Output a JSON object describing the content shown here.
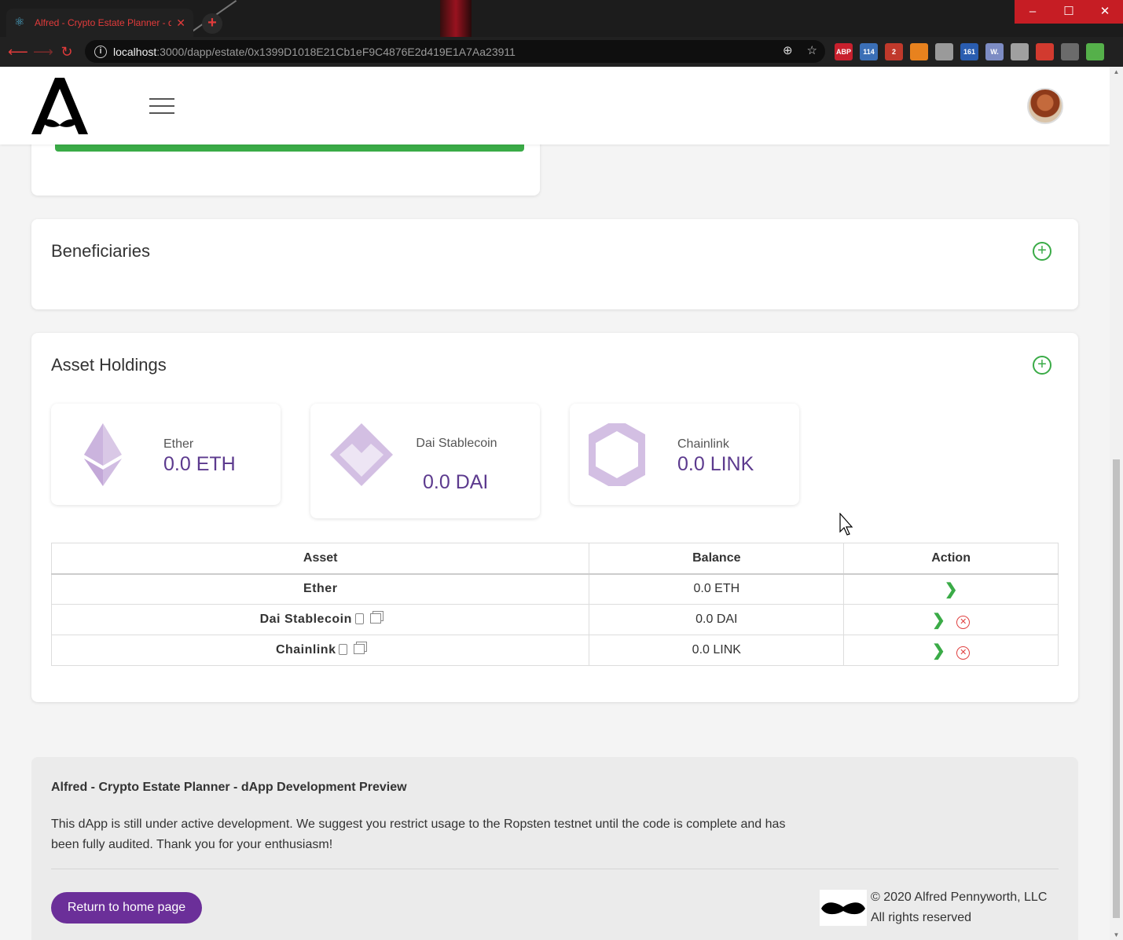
{
  "browser": {
    "tab_title": "Alfred - Crypto Estate Planner - d",
    "tab_close": "✕",
    "new_tab": "+",
    "url_host": "localhost",
    "url_rest": ":3000/dapp/estate/0x1399D1018E21Cb1eF9C4876E2d419E1A7Aa23911",
    "window_buttons": {
      "minimize": "–",
      "maximize": "☐",
      "close": "✕"
    },
    "extensions": [
      {
        "label": "ABP",
        "color": "#c8202d"
      },
      {
        "label": "114",
        "color": "#3b6fb6"
      },
      {
        "label": "2",
        "color": "#c0392b"
      },
      {
        "label": "",
        "color": "#e8821e"
      },
      {
        "label": "",
        "color": "#9a9a9a"
      },
      {
        "label": "161",
        "color": "#2a5db0"
      },
      {
        "label": "W.",
        "color": "#7d8cc4"
      },
      {
        "label": "",
        "color": "#a0a0a0"
      },
      {
        "label": "",
        "color": "#d23a2f"
      },
      {
        "label": "",
        "color": "#6b6b6b"
      },
      {
        "label": "",
        "color": "#55b04a"
      }
    ]
  },
  "header": {
    "logo": "alfred-logo",
    "menu_icon": "hamburger-icon",
    "avatar": "user-avatar"
  },
  "beneficiaries": {
    "title": "Beneficiaries",
    "add_icon": "+"
  },
  "assets": {
    "title": "Asset Holdings",
    "add_icon": "+",
    "tiles": [
      {
        "name": "Ether",
        "balance": "0.0 ETH",
        "icon": "ethereum-icon"
      },
      {
        "name": "Dai Stablecoin",
        "balance": "0.0 DAI",
        "icon": "dai-icon"
      },
      {
        "name": "Chainlink",
        "balance": "0.0 LINK",
        "icon": "chainlink-icon"
      }
    ],
    "table": {
      "headers": [
        "Asset",
        "Balance",
        "Action"
      ],
      "rows": [
        {
          "asset": "Ether",
          "balance": "0.0 ETH"
        },
        {
          "asset": "Dai Stablecoin",
          "balance": "0.0 DAI"
        },
        {
          "asset": "Chainlink",
          "balance": "0.0 LINK"
        }
      ],
      "action_go": "❯",
      "action_remove": "✕"
    }
  },
  "footer": {
    "title": "Alfred - Crypto Estate Planner - dApp Development Preview",
    "text": "This dApp is still under active development. We suggest you restrict usage to the Ropsten testnet until the code is complete and has been fully audited. Thank you for your enthusiasm!",
    "home_button": "Return to home page",
    "copyright_line1": "© 2020 Alfred Pennyworth, LLC",
    "copyright_line2": "All rights reserved"
  },
  "colors": {
    "accent_purple": "#6b2f99",
    "balance_purple": "#5c3a8e",
    "success_green": "#3aab47",
    "danger_red": "#e04040"
  }
}
